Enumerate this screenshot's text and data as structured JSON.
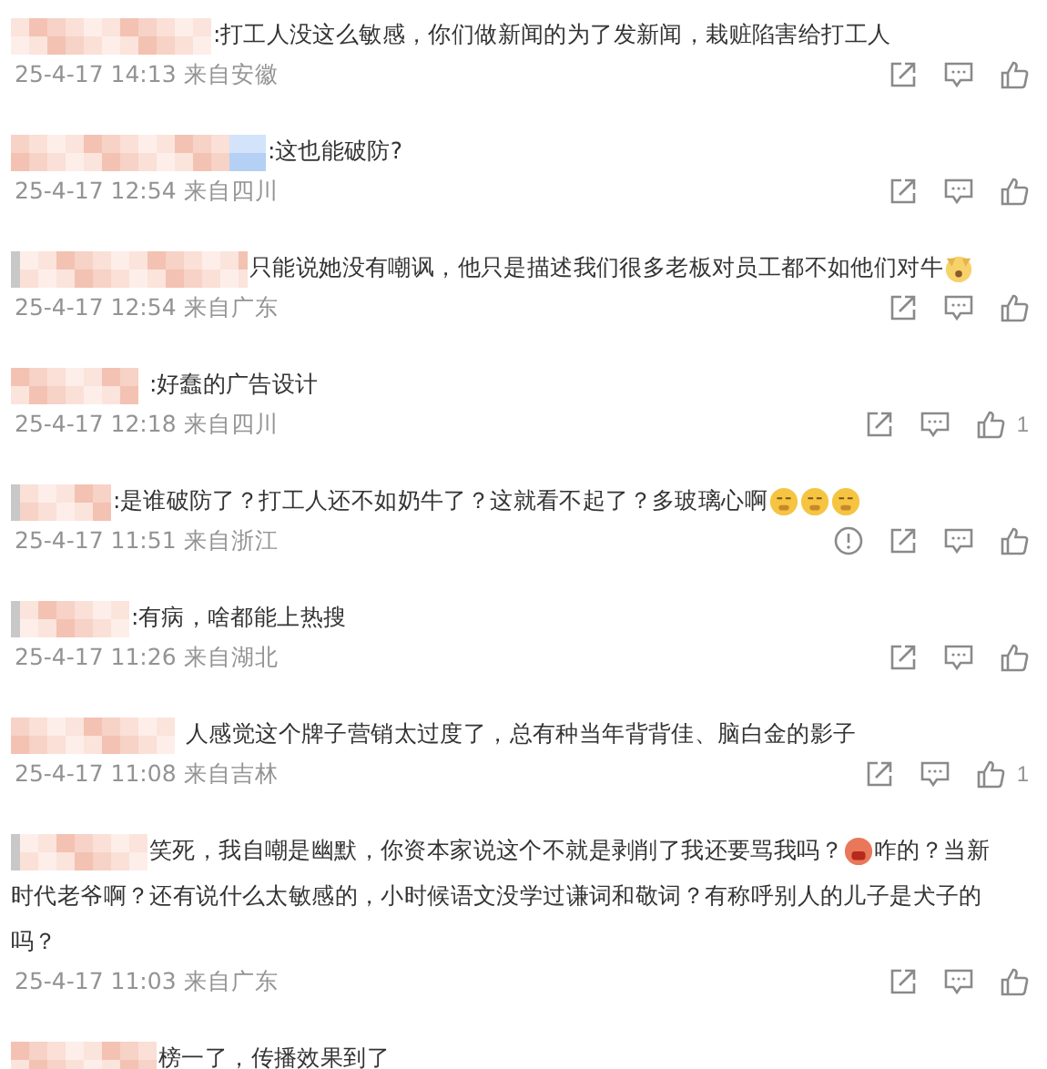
{
  "comments": [
    {
      "segments": [
        {
          "kind": "text",
          "text": ":打工人没这么敏感，你们做新闻的为了发新闻，栽赃陷害给打工人"
        }
      ],
      "meta": "25-4-17 14:13 来自安徽"
    },
    {
      "segments": [
        {
          "kind": "text",
          "text": ":这也能破防?"
        }
      ],
      "meta": "25-4-17 12:54 来自四川"
    },
    {
      "segments": [
        {
          "kind": "text",
          "text": "只能说她没有嘲讽，他只是描述我们很多老板对员工都不如他们对牛"
        },
        {
          "kind": "dog"
        }
      ],
      "meta": "25-4-17 12:54 来自广东"
    },
    {
      "segments": [
        {
          "kind": "text",
          "text": ":好蠢的广告设计"
        }
      ],
      "meta": "25-4-17 12:18 来自四川",
      "like_count": "1"
    },
    {
      "segments": [
        {
          "kind": "text",
          "text": ":是谁破防了？打工人还不如奶牛了？这就看不起了？多玻璃心啊"
        },
        {
          "kind": "shush"
        },
        {
          "kind": "shush"
        },
        {
          "kind": "shush"
        }
      ],
      "meta": "25-4-17 11:51 来自浙江",
      "report_button": true
    },
    {
      "segments": [
        {
          "kind": "text",
          "text": ":有病，啥都能上热搜"
        }
      ],
      "meta": "25-4-17 11:26 来自湖北"
    },
    {
      "segments": [
        {
          "kind": "text",
          "text": "人感觉这个牌子营销太过度了，总有种当年背背佳、脑白金的影子"
        }
      ],
      "meta": "25-4-17 11:08 来自吉林",
      "like_count": "1"
    },
    {
      "segments": [
        {
          "kind": "text",
          "text": "笑死，我自嘲是幽默，你资本家说这个不就是剥削了我还要骂我吗？"
        },
        {
          "kind": "angry"
        },
        {
          "kind": "text",
          "text": "咋的？当新"
        },
        {
          "kind": "wrapped",
          "text": "时代老爷啊？还有说什么太敏感的，小时候语文没学过谦词和敬词？有称呼别人的儿子是犬子的吗？"
        }
      ],
      "meta": "25-4-17 11:03 来自广东"
    },
    {
      "segments": [
        {
          "kind": "text",
          "text": "榜一了，传播效果到了"
        }
      ]
    }
  ]
}
